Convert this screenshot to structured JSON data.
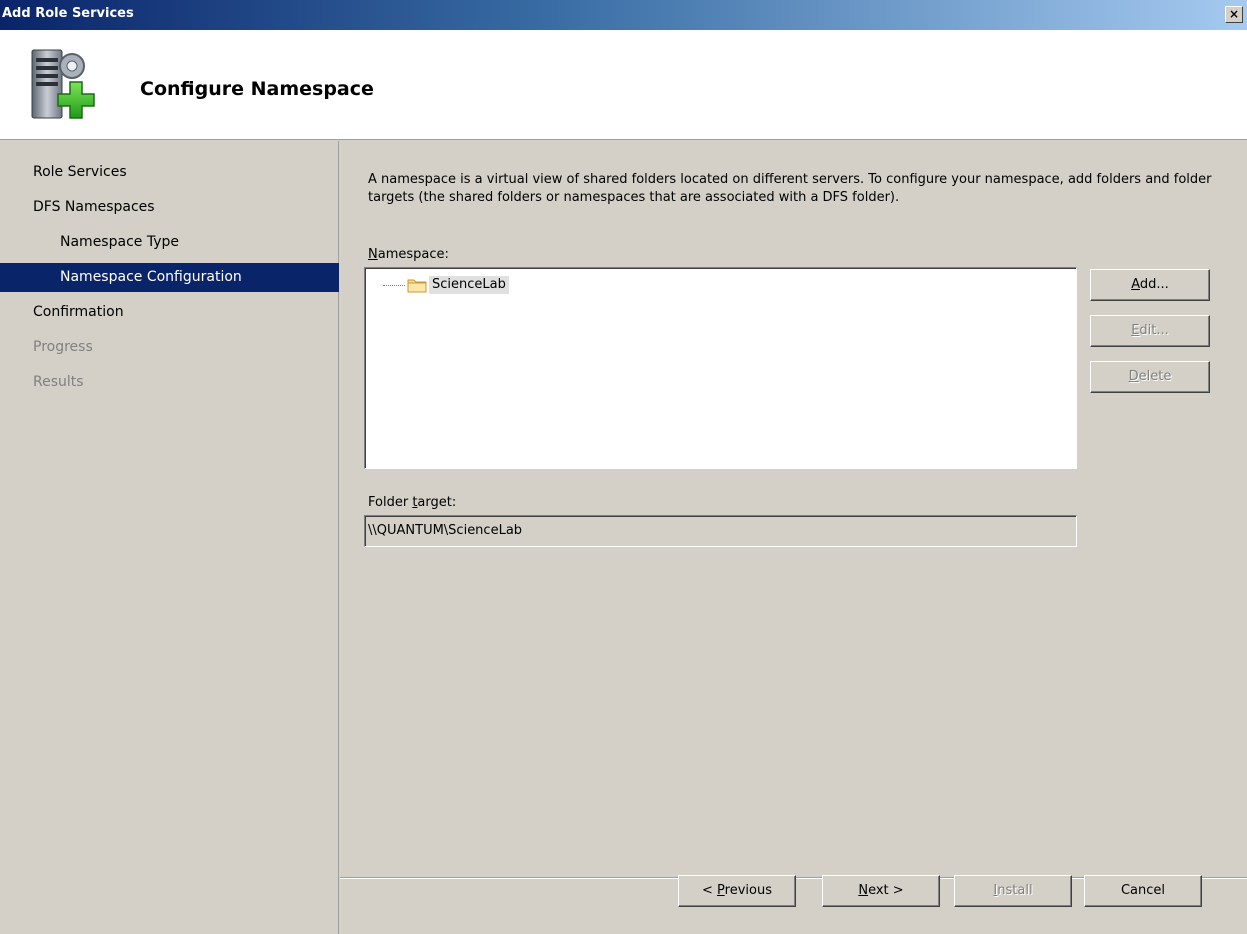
{
  "window": {
    "title": "Add Role Services",
    "close_glyph": "×"
  },
  "banner": {
    "heading": "Configure Namespace",
    "icon": "server-add-icon"
  },
  "nav": {
    "items": [
      {
        "label": "Role Services"
      },
      {
        "label": "DFS Namespaces"
      },
      {
        "label": "Namespace Type"
      },
      {
        "label": "Namespace Configuration"
      },
      {
        "label": "Confirmation"
      },
      {
        "label": "Progress"
      },
      {
        "label": "Results"
      }
    ]
  },
  "main": {
    "description": "A namespace is a virtual view of shared folders located on different servers. To configure your namespace, add folders and folder targets (the shared folders or namespaces that are associated with a DFS folder).",
    "namespace_label_mnemonic": "N",
    "namespace_label_rest": "amespace:",
    "tree": {
      "nodes": [
        {
          "label": "ScienceLab",
          "icon": "folder-icon"
        }
      ]
    },
    "folder_target_label_pre": "Folder ",
    "folder_target_label_mnemonic": "t",
    "folder_target_label_post": "arget:",
    "folder_target_value": "\\\\QUANTUM\\ScienceLab"
  },
  "side_buttons": {
    "add": {
      "mnemonic": "A",
      "rest": "dd..."
    },
    "edit": {
      "mnemonic": "E",
      "rest": "dit..."
    },
    "delete": {
      "mnemonic": "D",
      "rest": "elete"
    }
  },
  "footer": {
    "previous": {
      "pre": "< ",
      "mnemonic": "P",
      "rest": "revious"
    },
    "next": {
      "mnemonic": "N",
      "rest": "ext >"
    },
    "install": {
      "mnemonic": "I",
      "rest": "nstall"
    },
    "cancel": {
      "label": "Cancel"
    }
  },
  "colors": {
    "selection": "#0a246a",
    "dialog_bg": "#d4d0c8",
    "disabled_text": "#808080"
  }
}
